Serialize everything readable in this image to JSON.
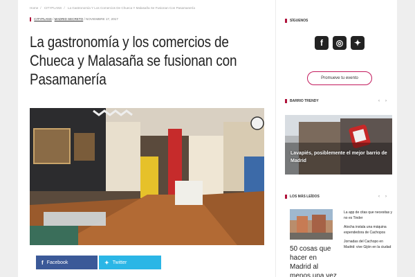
{
  "breadcrumb": {
    "home": "Home",
    "section": "CITYPLANS",
    "current": "La Gastronomía Y Los Comercios De Chueca Y Malasaña Se Fusionan Con Pasamanería"
  },
  "meta": {
    "category": "CITYPLANS",
    "subcategory": "MADRID SECRETO",
    "date": "NOVIEMBRE 17, 2017"
  },
  "article": {
    "title": "La gastronomía y los comercios de Chueca y Malasaña se fusionan con Pasamanería"
  },
  "share": {
    "facebook_label": "Facebook",
    "twitter_label": "Twitter"
  },
  "sidebar": {
    "follow_heading": "SÍGUENOS",
    "promo_label": "Promueve tu evento",
    "trendy_heading": "BARRIO TRENDY",
    "trendy_caption": "Lavapiés, posiblemente el mejor barrio de Madrid",
    "most_read_heading": "LOS MÁS LEÍDOS",
    "most_read_lead": "50 cosas que hacer en Madrid al menos una vez",
    "most_read_items": [
      "La app de citas que necesitas y no es Tinder",
      "Atocha instala una máquina expendedora de Cachopos",
      "Jornadas del Cachopo en Madrid: vive Gijón en la ciudad"
    ]
  },
  "colors": {
    "accent": "#b0123b",
    "facebook": "#3b5998",
    "twitter": "#2bb6e6"
  }
}
